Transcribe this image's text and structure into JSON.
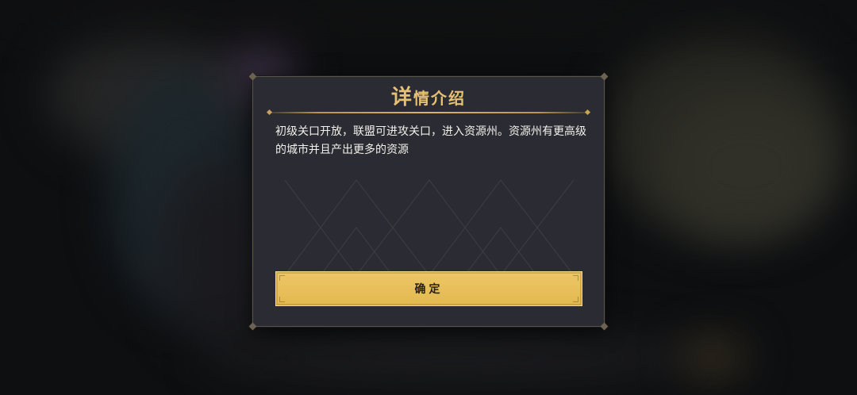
{
  "dialog": {
    "title_first_char": "详",
    "title_rest": "情介绍",
    "description": "初级关口开放，联盟可进攻关口，进入资源州。资源州有更高级的城市并且产出更多的资源",
    "confirm_label": "确定"
  },
  "colors": {
    "dialog_bg": "#2b2b33",
    "title_gold": "#e6c173",
    "button_gold": "#e8bf57",
    "text": "#f2f0ea"
  }
}
